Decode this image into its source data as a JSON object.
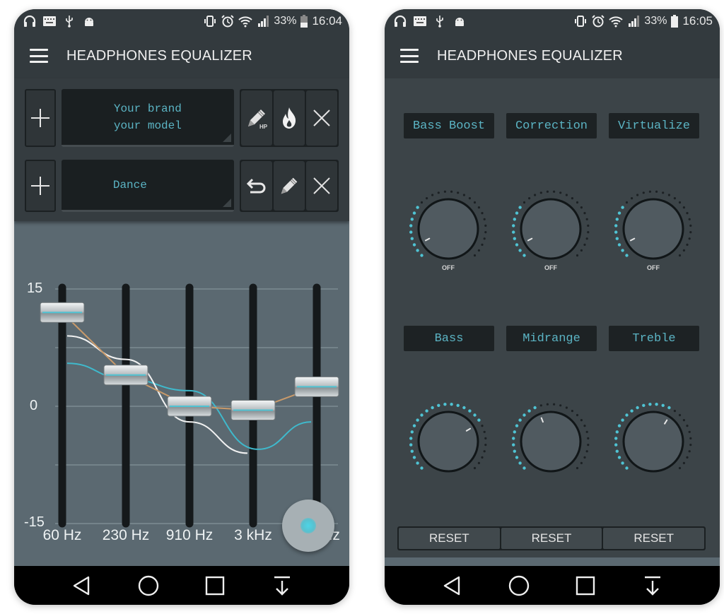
{
  "colors": {
    "accent": "#4fc3d3",
    "eq_background": "#5b6971",
    "toolbar": "#333a3e",
    "lcd_text": "#5bb4c4",
    "curve_orange": "#c99a6a",
    "curve_white": "#f2f2f2",
    "curve_cyan": "#3fb9cc"
  },
  "left": {
    "statusbar": {
      "left_icons": [
        "headphones-icon",
        "keyboard-icon",
        "usb-icon",
        "android-debug-icon"
      ],
      "right_icons": [
        "vibrate-icon",
        "alarm-icon",
        "wifi-icon",
        "signal-icon"
      ],
      "battery": "33%",
      "time": "16:04"
    },
    "appbar": {
      "title": "HEADPHONES EQUALIZER",
      "menu_icon": "hamburger-menu-icon"
    },
    "presets": [
      {
        "add_label": "+",
        "display_lines": [
          "Your brand",
          "your model"
        ],
        "actions": [
          {
            "name": "edit-headphones",
            "icon": "pencil-hp-icon",
            "badge": "HP"
          },
          {
            "name": "burn-in",
            "icon": "flame-icon"
          },
          {
            "name": "remove",
            "icon": "close-icon"
          }
        ]
      },
      {
        "add_label": "+",
        "display_lines": [
          "Dance"
        ],
        "actions": [
          {
            "name": "undo",
            "icon": "undo-icon"
          },
          {
            "name": "edit",
            "icon": "pencil-icon"
          },
          {
            "name": "remove",
            "icon": "close-icon"
          }
        ]
      }
    ],
    "equalizer": {
      "y_max_label": "15",
      "y_mid_label": "0",
      "y_min_label": "-15",
      "bands": [
        {
          "label": "60 Hz",
          "gain_db": 12
        },
        {
          "label": "230 Hz",
          "gain_db": 4
        },
        {
          "label": "910 Hz",
          "gain_db": 0
        },
        {
          "label": "3 kHz",
          "gain_db": -0.5
        },
        {
          "label": "14 kHz",
          "gain_db": 2.5
        }
      ],
      "visible_last_label": "Hz",
      "curves": {
        "preset_orange_db": [
          12,
          4,
          0,
          -0.5,
          2.5
        ],
        "headphone_white_db": [
          9,
          6,
          -2,
          -6
        ],
        "response_cyan_db": [
          5.5,
          3.5,
          2,
          -5.5,
          -2
        ]
      },
      "fab_icon": "fab-dot-icon"
    },
    "navbar": [
      "back-icon",
      "home-icon",
      "recents-icon",
      "notifications-down-icon"
    ]
  },
  "right": {
    "statusbar": {
      "left_icons": [
        "headphones-icon",
        "keyboard-icon",
        "usb-icon",
        "android-debug-icon"
      ],
      "right_icons": [
        "vibrate-icon",
        "alarm-icon",
        "wifi-icon",
        "signal-icon"
      ],
      "battery": "33%",
      "time": "16:05"
    },
    "appbar": {
      "title": "HEADPHONES EQUALIZER",
      "menu_icon": "hamburger-menu-icon"
    },
    "effects": [
      {
        "label": "Bass Boost",
        "value_text": "OFF",
        "level": 0.0
      },
      {
        "label": "Correction",
        "value_text": "OFF",
        "level": 0.0
      },
      {
        "label": "Virtualize",
        "value_text": "OFF",
        "level": 0.0
      }
    ],
    "tone": [
      {
        "label": "Bass",
        "level": 0.72
      },
      {
        "label": "Midrange",
        "level": 0.42
      },
      {
        "label": "Treble",
        "level": 0.62
      }
    ],
    "reset_labels": [
      "RESET",
      "RESET",
      "RESET"
    ],
    "navbar": [
      "back-icon",
      "home-icon",
      "recents-icon",
      "notifications-down-icon"
    ]
  }
}
